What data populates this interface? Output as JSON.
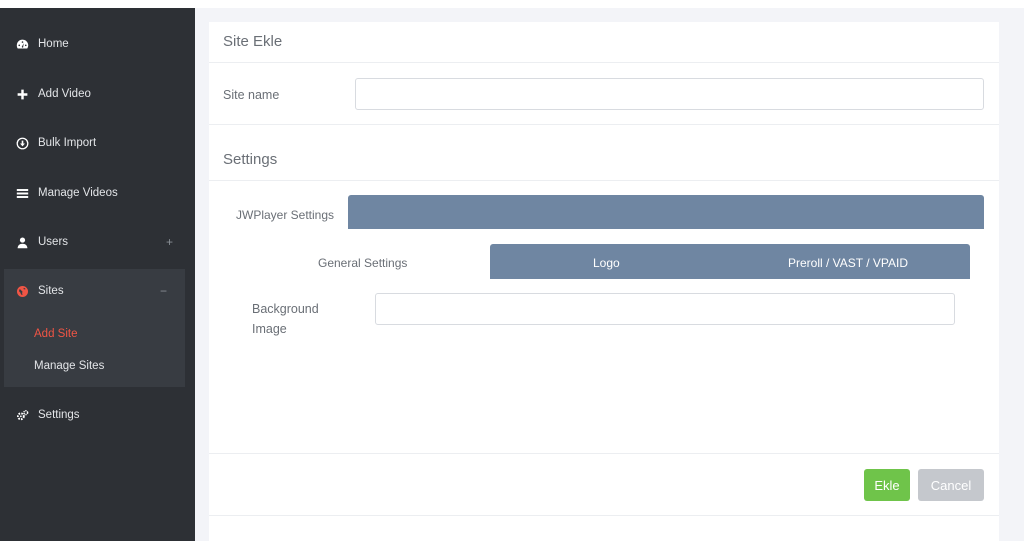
{
  "sidebar": {
    "items": [
      {
        "label": "Home",
        "icon": "dashboard-icon"
      },
      {
        "label": "Add Video",
        "icon": "plus-icon"
      },
      {
        "label": "Bulk Import",
        "icon": "download-circle-icon"
      },
      {
        "label": "Manage Videos",
        "icon": "list-icon"
      },
      {
        "label": "Users",
        "icon": "user-icon",
        "trail": "+"
      },
      {
        "label": "Sites",
        "icon": "globe-icon",
        "trail": "−"
      },
      {
        "label": "Settings",
        "icon": "gears-icon"
      }
    ],
    "sub_items": [
      {
        "label": "Add Site"
      },
      {
        "label": "Manage Sites"
      }
    ]
  },
  "form": {
    "title": "Site Ekle",
    "site_name_label": "Site name",
    "site_name_value": "",
    "settings_title": "Settings",
    "player_tab": "JWPlayer Settings",
    "tabs": [
      {
        "label": "General Settings"
      },
      {
        "label": "Logo"
      },
      {
        "label": "Preroll / VAST / VPAID"
      }
    ],
    "bg_label_line1": "Background",
    "bg_label_line2": "Image",
    "bg_value": ""
  },
  "actions": {
    "submit_label": "Ekle",
    "cancel_label": "Cancel"
  },
  "colors": {
    "sidebar_bg": "#2d3035",
    "active_sub": "#f05545",
    "tab_bar": "#6f86a2",
    "submit": "#6fc44a",
    "cancel": "#c5c8cd"
  }
}
